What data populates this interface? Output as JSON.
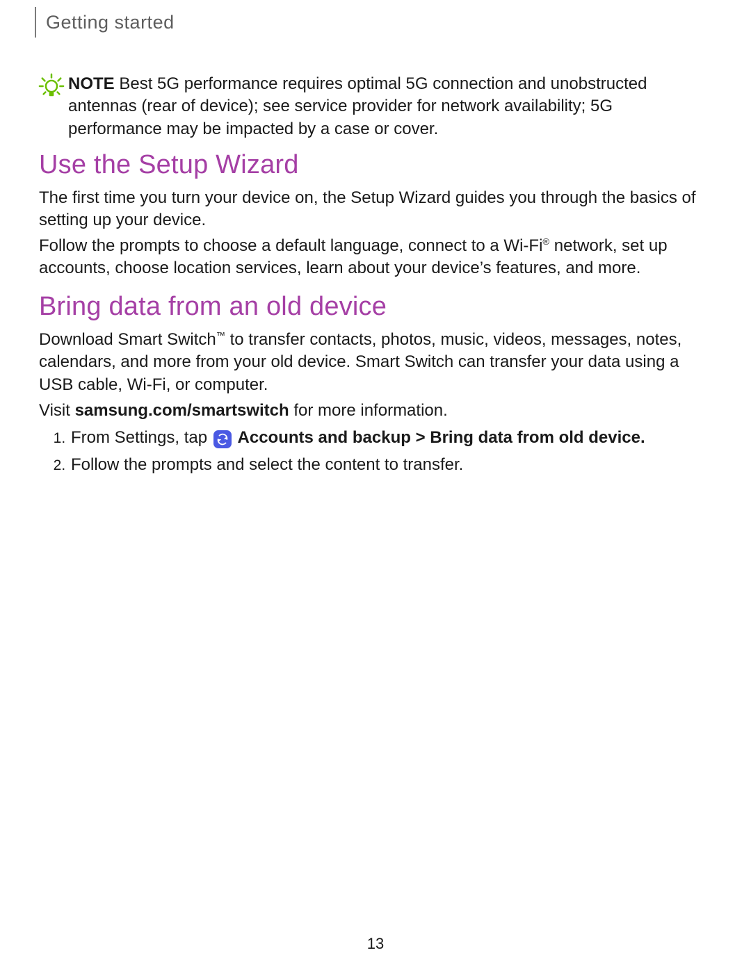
{
  "header": {
    "breadcrumb": "Getting started"
  },
  "note": {
    "label": "NOTE",
    "text": "Best 5G performance requires optimal 5G connection and unobstructed antennas (rear of device); see service provider for network availability; 5G performance may be impacted by a case or cover."
  },
  "sections": {
    "setup_wizard": {
      "heading": "Use the Setup Wizard",
      "paragraphs": [
        "The first time you turn your device on, the Setup Wizard guides you through the basics of setting up your device.",
        "Follow the prompts to choose a default language, connect to a Wi-Fi® network, set up accounts, choose location services, learn about your device’s features, and more."
      ]
    },
    "bring_data": {
      "heading": "Bring data from an old device",
      "intro": "Download Smart Switch™ to transfer contacts, photos, music, videos, messages, notes, calendars, and more from your old device. Smart Switch can transfer your data using a USB cable, Wi-Fi, or computer.",
      "visit_prefix": "Visit ",
      "visit_bold": "samsung.com/smartswitch",
      "visit_suffix": " for more information.",
      "steps": [
        {
          "pre": "From Settings, tap ",
          "icon": "sync-icon",
          "bold": " Accounts and backup > Bring data from old device.",
          "post": ""
        },
        {
          "pre": "Follow the prompts and select the content to transfer.",
          "icon": "",
          "bold": "",
          "post": ""
        }
      ]
    }
  },
  "page_number": "13",
  "colors": {
    "accent_heading": "#a53fa5",
    "note_icon": "#6bbf00",
    "inline_icon_bg": "#4a59e3"
  }
}
